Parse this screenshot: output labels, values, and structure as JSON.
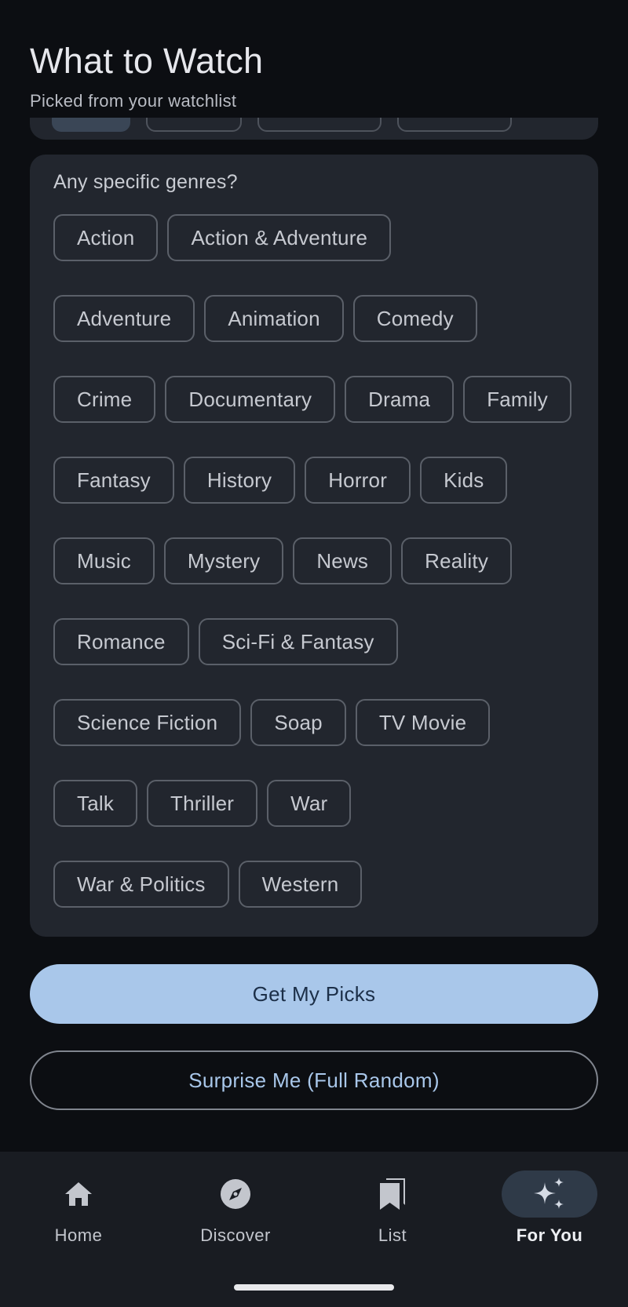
{
  "header": {
    "title": "What to Watch",
    "subtitle": "Picked from your watchlist"
  },
  "genres": {
    "question": "Any specific genres?",
    "rows": [
      [
        "Action",
        "Action & Adventure"
      ],
      [
        "Adventure",
        "Animation",
        "Comedy"
      ],
      [
        "Crime",
        "Documentary",
        "Drama",
        "Family"
      ],
      [
        "Fantasy",
        "History",
        "Horror",
        "Kids"
      ],
      [
        "Music",
        "Mystery",
        "News",
        "Reality"
      ],
      [
        "Romance",
        "Sci-Fi & Fantasy"
      ],
      [
        "Science Fiction",
        "Soap",
        "TV Movie"
      ],
      [
        "Talk",
        "Thriller",
        "War"
      ],
      [
        "War & Politics",
        "Western"
      ]
    ]
  },
  "actions": {
    "primary": "Get My Picks",
    "secondary": "Surprise Me (Full Random)"
  },
  "nav": {
    "items": [
      {
        "label": "Home",
        "icon": "home-icon"
      },
      {
        "label": "Discover",
        "icon": "compass-icon"
      },
      {
        "label": "List",
        "icon": "bookmarks-icon"
      },
      {
        "label": "For You",
        "icon": "sparkle-icon"
      }
    ],
    "active": "For You"
  },
  "colors": {
    "background": "#0c0e12",
    "card": "#22262e",
    "accent": "#a9c7ea",
    "nav": "#191c22"
  }
}
